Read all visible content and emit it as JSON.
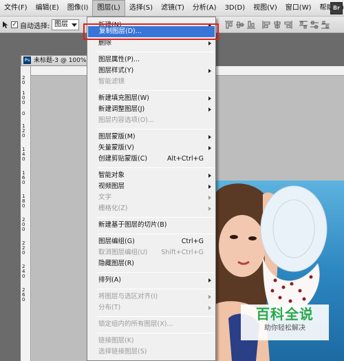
{
  "menubar": {
    "items": [
      {
        "label": "文件(F)"
      },
      {
        "label": "编辑(E)"
      },
      {
        "label": "图像(I)"
      },
      {
        "label": "图层(L)"
      },
      {
        "label": "选择(S)"
      },
      {
        "label": "滤镜(T)"
      },
      {
        "label": "分析(A)"
      },
      {
        "label": "3D(D)"
      },
      {
        "label": "视图(V)"
      },
      {
        "label": "窗口(W)"
      },
      {
        "label": "帮助(H)"
      }
    ],
    "bridge_label": "Br"
  },
  "options_bar": {
    "auto_select_label": "自动选择:",
    "auto_select_checked": true,
    "target_value": "图层"
  },
  "document": {
    "tab_icon": "Ps",
    "tab_title": "未标题-3 @ 100%",
    "ruler_v_digits": [
      "2",
      "0",
      "1",
      "0",
      "0",
      "0",
      "1",
      "2",
      "0",
      "1",
      "4",
      "0",
      "1",
      "6",
      "0",
      "1",
      "8",
      "0",
      "2",
      "0",
      "0",
      "2",
      "2",
      "0",
      "2",
      "4",
      "0",
      "2",
      "6",
      "0"
    ]
  },
  "menu": {
    "items": [
      {
        "label": "新建(N)",
        "submenu": true,
        "disabled": false
      },
      {
        "label": "复制图层(D)...",
        "highlighted": true,
        "disabled": false
      },
      {
        "label": "删除",
        "submenu": true,
        "disabled": false
      },
      {
        "label": "图层属性(P)...",
        "disabled": false
      },
      {
        "label": "图层样式(Y)",
        "submenu": true,
        "disabled": false
      },
      {
        "label": "智能滤镜",
        "disabled": true
      },
      {
        "label": "新建填充图层(W)",
        "submenu": true,
        "disabled": false
      },
      {
        "label": "新建调整图层(J)",
        "submenu": true,
        "disabled": false
      },
      {
        "label": "图层内容选项(O)...",
        "disabled": true
      },
      {
        "label": "图层蒙版(M)",
        "submenu": true,
        "disabled": false
      },
      {
        "label": "矢量蒙版(V)",
        "submenu": true,
        "disabled": false
      },
      {
        "label": "创建剪贴蒙版(C)",
        "shortcut": "Alt+Ctrl+G",
        "disabled": false
      },
      {
        "label": "智能对象",
        "submenu": true,
        "disabled": false
      },
      {
        "label": "视频图层",
        "submenu": true,
        "disabled": false
      },
      {
        "label": "文字",
        "submenu": true,
        "disabled": true
      },
      {
        "label": "栅格化(Z)",
        "submenu": true,
        "disabled": true
      },
      {
        "label": "新建基于图层的切片(B)",
        "disabled": false
      },
      {
        "label": "图层编组(G)",
        "shortcut": "Ctrl+G",
        "disabled": false
      },
      {
        "label": "取消图层编组(U)",
        "shortcut": "Shift+Ctrl+G",
        "disabled": true
      },
      {
        "label": "隐藏图层(R)",
        "disabled": false
      },
      {
        "label": "排列(A)",
        "submenu": true,
        "disabled": false
      },
      {
        "label": "将图层与选区对齐(I)",
        "submenu": true,
        "disabled": true
      },
      {
        "label": "分布(T)",
        "submenu": true,
        "disabled": true
      },
      {
        "label": "锁定组内的所有图层(X)...",
        "disabled": true
      },
      {
        "label": "链接图层(K)",
        "disabled": true
      },
      {
        "label": "选择链接图层(S)",
        "disabled": true
      }
    ]
  },
  "watermark": {
    "title": "百科全说",
    "subtitle": "助你轻松解决",
    "color": "#29a84a"
  },
  "colors": {
    "highlight": "#3875d7",
    "annotation_box": "#e02020"
  }
}
